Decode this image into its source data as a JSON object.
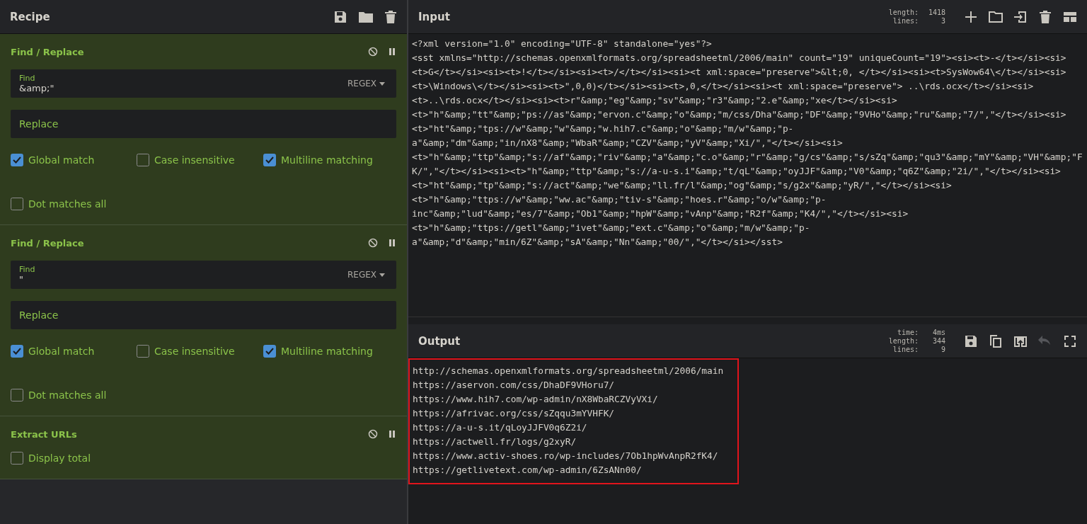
{
  "recipe": {
    "title": "Recipe",
    "operations": [
      {
        "kind": "find_replace",
        "title": "Find / Replace",
        "find_label": "Find",
        "find_value": "&amp;\"",
        "mode": "REGEX",
        "replace_placeholder": "Replace",
        "options": [
          {
            "label": "Global match",
            "checked": true
          },
          {
            "label": "Case insensitive",
            "checked": false
          },
          {
            "label": "Multiline matching",
            "checked": true
          },
          {
            "label": "Dot matches all",
            "checked": false
          }
        ]
      },
      {
        "kind": "find_replace",
        "title": "Find / Replace",
        "find_label": "Find",
        "find_value": "\"",
        "mode": "REGEX",
        "replace_placeholder": "Replace",
        "options": [
          {
            "label": "Global match",
            "checked": true
          },
          {
            "label": "Case insensitive",
            "checked": false
          },
          {
            "label": "Multiline matching",
            "checked": true
          },
          {
            "label": "Dot matches all",
            "checked": false
          }
        ]
      },
      {
        "kind": "extract_urls",
        "title": "Extract URLs",
        "options": [
          {
            "label": "Display total",
            "checked": false
          }
        ]
      }
    ]
  },
  "input": {
    "title": "Input",
    "stats": [
      {
        "label": "length:",
        "value": "1418"
      },
      {
        "label": "lines:",
        "value": "3"
      }
    ],
    "lines": [
      "<?xml version=\"1.0\" encoding=\"UTF-8\" standalone=\"yes\"?>",
      "<sst xmlns=\"http://schemas.openxmlformats.org/spreadsheetml/2006/main\" count=\"19\" uniqueCount=\"19\"><si><t>-</t></si><si>",
      "<t>G</t></si><si><t>!</t></si><si><t>/</t></si><si><t xml:space=\"preserve\">&lt;0, </t></si><si><t>SysWow64\\</t></si><si>",
      "<t>\\Windows\\</t></si><si><t>\",0,0)</t></si><si><t>,0,</t></si><si><t xml:space=\"preserve\"> ..\\rds.ocx</t></si><si>",
      "<t>..\\rds.ocx</t></si><si><t>r\"&amp;\"eg\"&amp;\"sv\"&amp;\"r3\"&amp;\"2.e\"&amp;\"xe</t></si><si>",
      "<t>\"h\"&amp;\"tt\"&amp;\"ps://as\"&amp;\"ervon.c\"&amp;\"o\"&amp;\"m/css/Dha\"&amp;\"DF\"&amp;\"9VHo\"&amp;\"ru\"&amp;\"7/\",\"</t></si><si>",
      "<t>\"ht\"&amp;\"tps://w\"&amp;\"w\"&amp;\"w.hih7.c\"&amp;\"o\"&amp;\"m/w\"&amp;\"p-",
      "a\"&amp;\"dm\"&amp;\"in/nX8\"&amp;\"WbaR\"&amp;\"CZV\"&amp;\"yV\"&amp;\"Xi/\",\"</t></si><si>",
      "<t>\"h\"&amp;\"ttp\"&amp;\"s://af\"&amp;\"riv\"&amp;\"a\"&amp;\"c.o\"&amp;\"r\"&amp;\"g/cs\"&amp;\"s/sZq\"&amp;\"qu3\"&amp;\"mY\"&amp;\"VH\"&amp;\"F",
      "K/\",\"</t></si><si><t>\"h\"&amp;\"ttp\"&amp;\"s://a-u-s.i\"&amp;\"t/qL\"&amp;\"oyJJF\"&amp;\"V0\"&amp;\"q6Z\"&amp;\"2i/\",\"</t></si><si>",
      "<t>\"ht\"&amp;\"tp\"&amp;\"s://act\"&amp;\"we\"&amp;\"ll.fr/l\"&amp;\"og\"&amp;\"s/g2x\"&amp;\"yR/\",\"</t></si><si>",
      "<t>\"h\"&amp;\"ttps://w\"&amp;\"ww.ac\"&amp;\"tiv-s\"&amp;\"hoes.r\"&amp;\"o/w\"&amp;\"p-",
      "inc\"&amp;\"lud\"&amp;\"es/7\"&amp;\"Ob1\"&amp;\"hpW\"&amp;\"vAnp\"&amp;\"R2f\"&amp;\"K4/\",\"</t></si><si>",
      "<t>\"h\"&amp;\"ttps://getl\"&amp;\"ivet\"&amp;\"ext.c\"&amp;\"o\"&amp;\"m/w\"&amp;\"p-",
      "a\"&amp;\"d\"&amp;\"min/6Z\"&amp;\"sA\"&amp;\"Nn\"&amp;\"00/\",\"</t></si></sst>"
    ]
  },
  "output": {
    "title": "Output",
    "stats": [
      {
        "label": "time:",
        "value": "4ms"
      },
      {
        "label": "length:",
        "value": "344"
      },
      {
        "label": "lines:",
        "value": "9"
      }
    ],
    "highlighted": true,
    "lines": [
      "http://schemas.openxmlformats.org/spreadsheetml/2006/main",
      "https://aservon.com/css/DhaDF9VHoru7/",
      "https://www.hih7.com/wp-admin/nX8WbaRCZVyVXi/",
      "https://afrivac.org/css/sZqqu3mYVHFK/",
      "https://a-u-s.it/qLoyJJFV0q6Z2i/",
      "https://actwell.fr/logs/g2xyR/",
      "https://www.activ-shoes.ro/wp-includes/7Ob1hpWvAnpR2fK4/",
      "https://getlivetext.com/wp-admin/6ZsANn00/"
    ],
    "tools": [
      {
        "kind": "save",
        "disabled": false
      },
      {
        "kind": "copy",
        "disabled": false
      },
      {
        "kind": "replace",
        "disabled": false
      },
      {
        "kind": "undo",
        "disabled": true
      },
      {
        "kind": "maximise",
        "disabled": false
      }
    ]
  }
}
